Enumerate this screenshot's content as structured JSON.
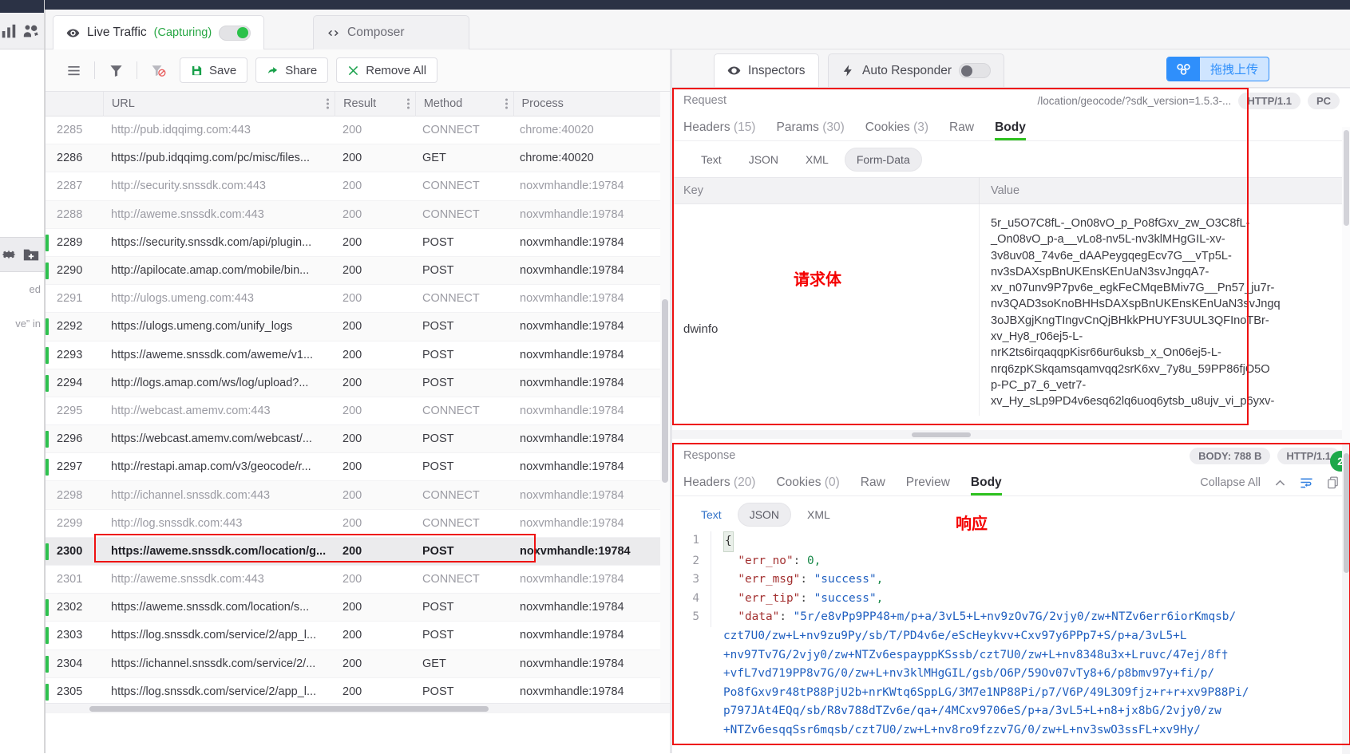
{
  "background_app": {
    "toolbar_icons_top": [
      "chart-icon",
      "users-gear-icon"
    ],
    "toolbar_icons_mid": [
      "gear-icon",
      "folder-add-icon"
    ],
    "text_fragment_1": "ed",
    "text_fragment_2": "ve” in"
  },
  "window": {
    "tabs": [
      {
        "label": "Live Traffic",
        "status": "(Capturing)",
        "icon": "eye-icon",
        "active": true,
        "toggle": "on"
      },
      {
        "label": "Composer",
        "icon": "code-icon",
        "active": false
      }
    ]
  },
  "toolbar": {
    "menu_icon": "hamburger-icon",
    "filter_icon": "filter-icon",
    "filter_off_icon": "filter-disabled-icon",
    "save_label": "Save",
    "save_icon": "save-icon",
    "share_label": "Share",
    "share_icon": "share-icon",
    "remove_all_label": "Remove All",
    "remove_all_icon": "close-x-icon"
  },
  "table": {
    "columns": [
      "",
      "URL",
      "Result",
      "Method",
      "Process"
    ],
    "rows": [
      {
        "id": "2285",
        "url": "http://pub.idqqimg.com:443",
        "result": "200",
        "method": "CONNECT",
        "process": "chrome:40020",
        "dim": true,
        "mark": ""
      },
      {
        "id": "2286",
        "url": "https://pub.idqqimg.com/pc/misc/files...",
        "result": "200",
        "method": "GET",
        "process": "chrome:40020",
        "dim": false,
        "mark": ""
      },
      {
        "id": "2287",
        "url": "http://security.snssdk.com:443",
        "result": "200",
        "method": "CONNECT",
        "process": "noxvmhandle:19784",
        "dim": true,
        "mark": ""
      },
      {
        "id": "2288",
        "url": "http://aweme.snssdk.com:443",
        "result": "200",
        "method": "CONNECT",
        "process": "noxvmhandle:19784",
        "dim": true,
        "mark": ""
      },
      {
        "id": "2289",
        "url": "https://security.snssdk.com/api/plugin...",
        "result": "200",
        "method": "POST",
        "process": "noxvmhandle:19784",
        "dim": false,
        "mark": "green"
      },
      {
        "id": "2290",
        "url": "http://apilocate.amap.com/mobile/bin...",
        "result": "200",
        "method": "POST",
        "process": "noxvmhandle:19784",
        "dim": false,
        "mark": "green"
      },
      {
        "id": "2291",
        "url": "http://ulogs.umeng.com:443",
        "result": "200",
        "method": "CONNECT",
        "process": "noxvmhandle:19784",
        "dim": true,
        "mark": ""
      },
      {
        "id": "2292",
        "url": "https://ulogs.umeng.com/unify_logs",
        "result": "200",
        "method": "POST",
        "process": "noxvmhandle:19784",
        "dim": false,
        "mark": "green"
      },
      {
        "id": "2293",
        "url": "https://aweme.snssdk.com/aweme/v1...",
        "result": "200",
        "method": "POST",
        "process": "noxvmhandle:19784",
        "dim": false,
        "mark": "green"
      },
      {
        "id": "2294",
        "url": "http://logs.amap.com/ws/log/upload?...",
        "result": "200",
        "method": "POST",
        "process": "noxvmhandle:19784",
        "dim": false,
        "mark": "green"
      },
      {
        "id": "2295",
        "url": "http://webcast.amemv.com:443",
        "result": "200",
        "method": "CONNECT",
        "process": "noxvmhandle:19784",
        "dim": true,
        "mark": ""
      },
      {
        "id": "2296",
        "url": "https://webcast.amemv.com/webcast/...",
        "result": "200",
        "method": "POST",
        "process": "noxvmhandle:19784",
        "dim": false,
        "mark": "green"
      },
      {
        "id": "2297",
        "url": "http://restapi.amap.com/v3/geocode/r...",
        "result": "200",
        "method": "POST",
        "process": "noxvmhandle:19784",
        "dim": false,
        "mark": "green"
      },
      {
        "id": "2298",
        "url": "http://ichannel.snssdk.com:443",
        "result": "200",
        "method": "CONNECT",
        "process": "noxvmhandle:19784",
        "dim": true,
        "mark": ""
      },
      {
        "id": "2299",
        "url": "http://log.snssdk.com:443",
        "result": "200",
        "method": "CONNECT",
        "process": "noxvmhandle:19784",
        "dim": true,
        "mark": ""
      },
      {
        "id": "2300",
        "url": "https://aweme.snssdk.com/location/g...",
        "result": "200",
        "method": "POST",
        "process": "noxvmhandle:19784",
        "dim": false,
        "mark": "green",
        "selected": true
      },
      {
        "id": "2301",
        "url": "http://aweme.snssdk.com:443",
        "result": "200",
        "method": "CONNECT",
        "process": "noxvmhandle:19784",
        "dim": true,
        "mark": ""
      },
      {
        "id": "2302",
        "url": "https://aweme.snssdk.com/location/s...",
        "result": "200",
        "method": "POST",
        "process": "noxvmhandle:19784",
        "dim": false,
        "mark": "green"
      },
      {
        "id": "2303",
        "url": "https://log.snssdk.com/service/2/app_l...",
        "result": "200",
        "method": "POST",
        "process": "noxvmhandle:19784",
        "dim": false,
        "mark": "green"
      },
      {
        "id": "2304",
        "url": "https://ichannel.snssdk.com/service/2/...",
        "result": "200",
        "method": "GET",
        "process": "noxvmhandle:19784",
        "dim": false,
        "mark": "green"
      },
      {
        "id": "2305",
        "url": "https://log.snssdk.com/service/2/app_l...",
        "result": "200",
        "method": "POST",
        "process": "noxvmhandle:19784",
        "dim": false,
        "mark": "green"
      }
    ]
  },
  "inspector": {
    "tabs": [
      {
        "label": "Inspectors",
        "icon": "eye-icon",
        "active": true
      },
      {
        "label": "Auto Responder",
        "icon": "bolt-icon",
        "active": false,
        "toggle": "off"
      }
    ],
    "upload_button": {
      "label": "拖拽上传",
      "icon": "cloud-upload-icon"
    }
  },
  "request": {
    "title": "Request",
    "url_fragment": "/location/geocode/?sdk_version=1.5.3-...",
    "badges": [
      "HTTP/1.1",
      "PC"
    ],
    "tabs": [
      {
        "label": "Headers",
        "count": "(15)",
        "active": false
      },
      {
        "label": "Params",
        "count": "(30)",
        "active": false
      },
      {
        "label": "Cookies",
        "count": "(3)",
        "active": false
      },
      {
        "label": "Raw",
        "count": "",
        "active": false
      },
      {
        "label": "Body",
        "count": "",
        "active": true
      }
    ],
    "formats": [
      "Text",
      "JSON",
      "XML",
      "Form-Data"
    ],
    "selected_format": "Form-Data",
    "kv_headers": [
      "Key",
      "Value"
    ],
    "annotation": "请求体",
    "entry_key": "dwinfo",
    "entry_value": "5r_u5O7C8fL-_On08vO_p_Po8fGxv_zw_O3C8fL-\n_On08vO_p-a__vLo8-nv5L-nv3klMHgGIL-xv-\n3v8uv08_74v6e_dAAPeygqegEcv7G__vTp5L-\nnv3sDAXspBnUKEnsKEnUaN3svJngqA7-\nxv_n07unv9P7pv6e_egkFeCMqeBMiv7G__Pn57_ju7r-\nnv3QAD3soKnoBHHsDAXspBnUKEnsKEnUaN3svJngq\n3oJBXgjKngTIngvCnQjBHkkPHUYF3UUL3QFInoTBr-\nxv_Hy8_r06ej5-L-\nnrK2ts6irqaqqpKisr66ur6uksb_x_On06ej5-L-\nnrq6zpKSkqamsqamvqq2srK6xv_7y8u_59PP86fjO5O\np-PC_p7_6_vetr7-\nxv_Hy_sLp9PD4v6esq62lq6uoq6ytsb_u8ujv_vi_p6yxv-"
  },
  "response": {
    "title": "Response",
    "badges": [
      "BODY: 788 B",
      "HTTP/1.1"
    ],
    "status_badge": "2",
    "tabs": [
      {
        "label": "Headers",
        "count": "(20)",
        "active": false
      },
      {
        "label": "Cookies",
        "count": "(0)",
        "active": false
      },
      {
        "label": "Raw",
        "count": "",
        "active": false
      },
      {
        "label": "Preview",
        "count": "",
        "active": false
      },
      {
        "label": "Body",
        "count": "",
        "active": true
      }
    ],
    "collapse_label": "Collapse All",
    "collapse_icon": "chevron-up-icon",
    "wrap_icon": "wrap-lines-icon",
    "copy_icon": "copy-icon",
    "formats": [
      "Text",
      "JSON",
      "XML"
    ],
    "selected_format": "JSON",
    "annotation": "响应",
    "json_lines": [
      {
        "no": "1",
        "content": "{",
        "type": "brace"
      },
      {
        "no": "2",
        "key": "\"err_no\"",
        "sep": ": ",
        "value": "0",
        "vtype": "num",
        "tail": ","
      },
      {
        "no": "3",
        "key": "\"err_msg\"",
        "sep": ": ",
        "value": "\"success\"",
        "vtype": "str",
        "tail": ","
      },
      {
        "no": "4",
        "key": "\"err_tip\"",
        "sep": ": ",
        "value": "\"success\"",
        "vtype": "str",
        "tail": ","
      },
      {
        "no": "5",
        "key": "\"data\"",
        "sep": ": ",
        "value": "\"5r/e8vPp9PP48+m/p+a/3vL5+L+nv9zOv7G/2vjy0/zw+NTZv6err6iorKmqsb/",
        "vtype": "str",
        "tail": ""
      }
    ],
    "json_wrapped_lines": [
      "czt7U0/zw+L+nv9zu9Py/sb/T/PD4v6e/eScHeykvv+Cxv97y6PPp7+S/p+a/3vL5+L",
      "+nv97Tv7G/2vjy0/zw+NTZv6espayppKSssb/czt7U0/zw+L+nv8348u3x+Lruvc/47ej/8f†",
      "+vfL7vd719PP8v7G/0/zw+L+nv3klMHgGIL/gsb/O6P/59Ov07vTy8+6/p8bmv97y+fi/p/",
      "Po8fGxv9r48tP88PjU2b+nrKWtq6SppLG/3M7e1NP88Pi/p7/V6P/49L3O9fjz+r+r+xv9P88Pi/",
      "p797JAt4EQq/sb/R8v788dTZv6e/qa+/4MCxv9706eS/p+a/3vL5+L+n8+jx8bG/2vjy0/zw",
      "+NTZv6esqqSsr6mqsb/czt7U0/zw+L+nv8ro9fzzv7G/0/zw+L+nv3swO3ssFL+xv9Hy/"
    ]
  }
}
